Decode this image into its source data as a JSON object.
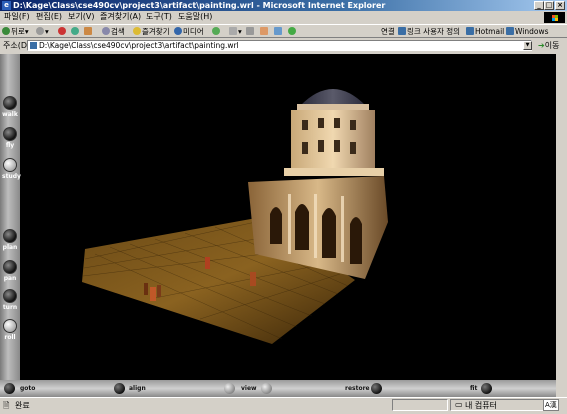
{
  "window": {
    "title": "D:\\Kage\\Class\\cse490cv\\project3\\artifact\\painting.wrl - Microsoft Internet Explorer"
  },
  "menu": [
    "파일(F)",
    "편집(E)",
    "보기(V)",
    "즐겨찾기(A)",
    "도구(T)",
    "도움말(H)"
  ],
  "toolbar": {
    "back": "뒤로",
    "search": "검색",
    "favorites": "즐겨찾기",
    "media": "미디어",
    "links_label": "연결",
    "links": [
      "링크 사용자 정의",
      "Hotmail",
      "Windows"
    ]
  },
  "address": {
    "label": "주소(D)",
    "value": "D:\\Kage\\Class\\cse490cv\\project3\\artifact\\painting.wrl",
    "go": "이동"
  },
  "viewer": {
    "left_controls": [
      "walk",
      "fly",
      "study",
      "plan",
      "pan",
      "turn",
      "roll"
    ],
    "active_control": "study",
    "bottom_controls": [
      "goto",
      "align",
      "view",
      "restore",
      "fit"
    ]
  },
  "status": {
    "text": "완료",
    "zone": "내 컴퓨터"
  },
  "colors": {
    "title_active": "#0a246a",
    "chrome": "#d4d0c8",
    "viewport": "#000000"
  }
}
